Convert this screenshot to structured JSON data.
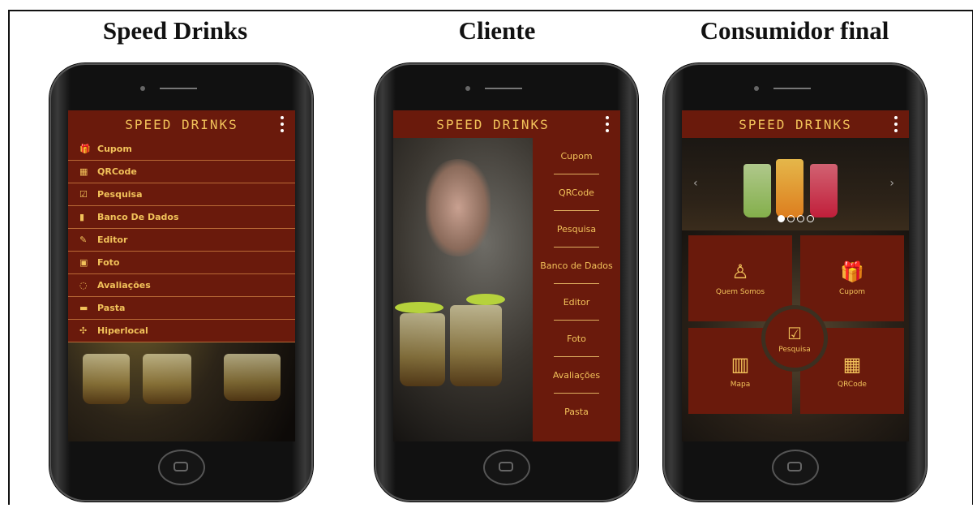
{
  "columns": {
    "left_title": "Speed Drinks",
    "mid_title": "Cliente",
    "right_title": "Consumidor final"
  },
  "app": {
    "title": "SPEED DRINKS"
  },
  "admin_menu": [
    {
      "icon": "gift-icon",
      "label": "Cupom"
    },
    {
      "icon": "qrcode-icon",
      "label": "QRCode"
    },
    {
      "icon": "checkbox-icon",
      "label": "Pesquisa"
    },
    {
      "icon": "database-icon",
      "label": "Banco De Dados"
    },
    {
      "icon": "edit-icon",
      "label": "Editor"
    },
    {
      "icon": "image-icon",
      "label": "Foto"
    },
    {
      "icon": "comment-icon",
      "label": "Avaliações"
    },
    {
      "icon": "folder-icon",
      "label": "Pasta"
    },
    {
      "icon": "hyperlocal-icon",
      "label": "Hiperlocal"
    }
  ],
  "client_menu": [
    "Cupom",
    "QRCode",
    "Pesquisa",
    "Banco de Dados",
    "Editor",
    "Foto",
    "Avaliações",
    "Pasta"
  ],
  "consumer_tiles": {
    "top_left": "Quem Somos",
    "top_right": "Cupom",
    "bottom_left": "Mapa",
    "bottom_right": "QRCode",
    "center": "Pesquisa"
  },
  "colors": {
    "accent": "#f2c25a",
    "brand": "#6a1a0c"
  }
}
